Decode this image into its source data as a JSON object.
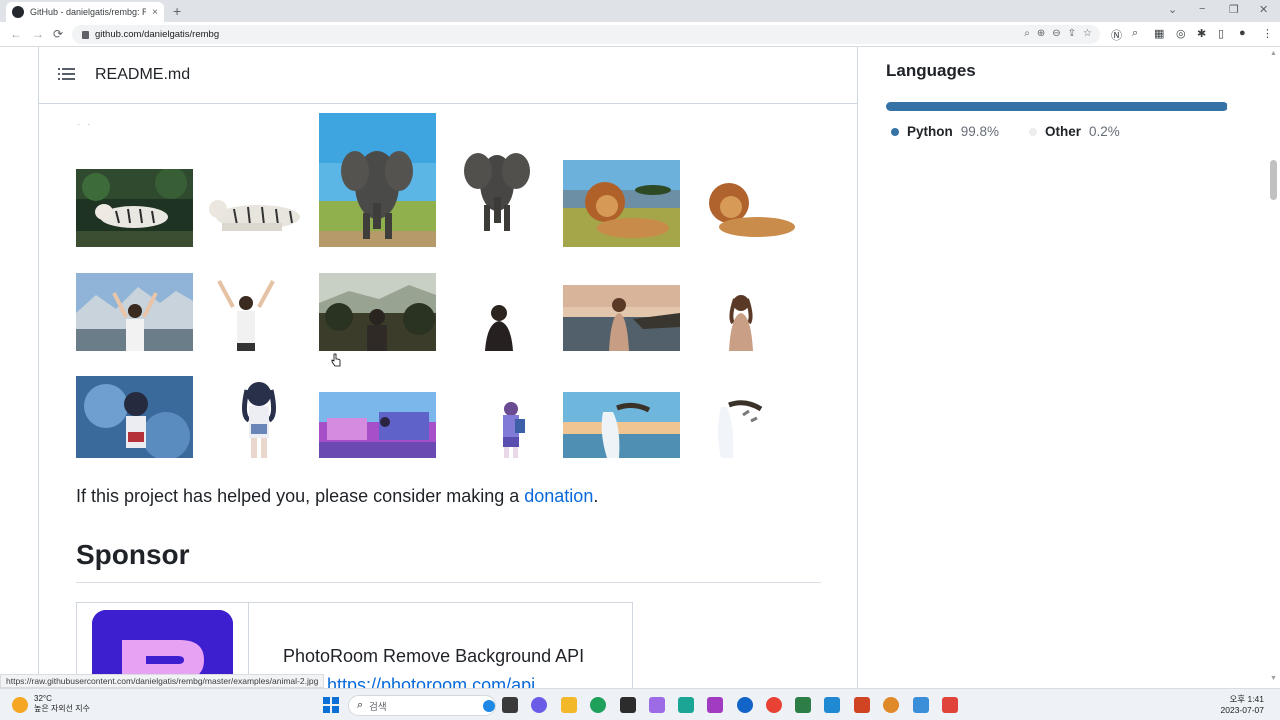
{
  "browser": {
    "tab_title": "GitHub - danielgatis/rembg: Re",
    "tab_close": "×",
    "new_tab": "+",
    "url": "github.com/danielgatis/rembg",
    "window_controls": [
      "⌄",
      "−",
      "❐",
      "✕"
    ],
    "nav": [
      "←",
      "→",
      "⟳"
    ]
  },
  "readme": {
    "title": "README.md",
    "donation_text": "If this project has helped you, please consider making a ",
    "donation_link": "donation",
    "donation_end": ".",
    "sponsor_heading": "Sponsor",
    "sponsor_name": "PhotoRoom Remove Background API",
    "sponsor_link": "https://photoroom.com/api"
  },
  "languages": {
    "heading": "Languages",
    "items": [
      {
        "name": "Python",
        "pct": "99.8%",
        "color": "#3572a5",
        "share": 0.998
      },
      {
        "name": "Other",
        "pct": "0.2%",
        "color": "#ededed",
        "share": 0.002
      }
    ]
  },
  "status_url": "https://raw.githubusercontent.com/danielgatis/rembg/master/examples/animal-2.jpg",
  "taskbar": {
    "temperature": "32°C",
    "weather_note": "높은 자외선 지수",
    "search_placeholder": "검색",
    "time": "오후 1:41",
    "date": "2023-07-07"
  }
}
